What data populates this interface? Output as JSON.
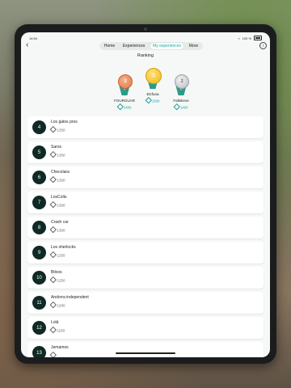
{
  "status": {
    "time": "14:54",
    "wifi": "wifi-icon",
    "battery_pct": "100 %",
    "battery_icon": "battery-icon"
  },
  "nav": {
    "back_icon": "chevron-left-icon",
    "info_icon": "info-icon",
    "tabs": [
      {
        "label": "Home",
        "active": false
      },
      {
        "label": "Experiences",
        "active": false
      },
      {
        "label": "My experiences",
        "active": true
      },
      {
        "label": "More",
        "active": false
      }
    ]
  },
  "ranking": {
    "title": "Ranking",
    "podium": [
      {
        "rank": "3",
        "name": "FOURGUAR",
        "score": "1400",
        "medal": "bronze"
      },
      {
        "rank": "1",
        "name": "Elcfuna",
        "score": "1500",
        "medal": "gold"
      },
      {
        "rank": "2",
        "name": "Fallekeve",
        "score": "1400",
        "medal": "silver"
      }
    ],
    "list": [
      {
        "pos": "4",
        "name": "Los gatos pros",
        "score": "1350"
      },
      {
        "pos": "5",
        "name": "Saros",
        "score": "1350"
      },
      {
        "pos": "6",
        "name": "Checolara",
        "score": "1350"
      },
      {
        "pos": "7",
        "name": "LosColts",
        "score": "1300"
      },
      {
        "pos": "8",
        "name": "Crash car",
        "score": "1300"
      },
      {
        "pos": "9",
        "name": "Los sherlocks",
        "score": "1250"
      },
      {
        "pos": "10",
        "name": "Bitxos",
        "score": "1250"
      },
      {
        "pos": "11",
        "name": "Andorra independent",
        "score": "1200"
      },
      {
        "pos": "12",
        "name": "Lolá",
        "score": "1150"
      },
      {
        "pos": "13",
        "name": "Jemamos",
        "score": ""
      }
    ]
  },
  "colors": {
    "accent": "#1aa3a0",
    "badge": "#0f2a24",
    "background": "#f5f8f6"
  }
}
